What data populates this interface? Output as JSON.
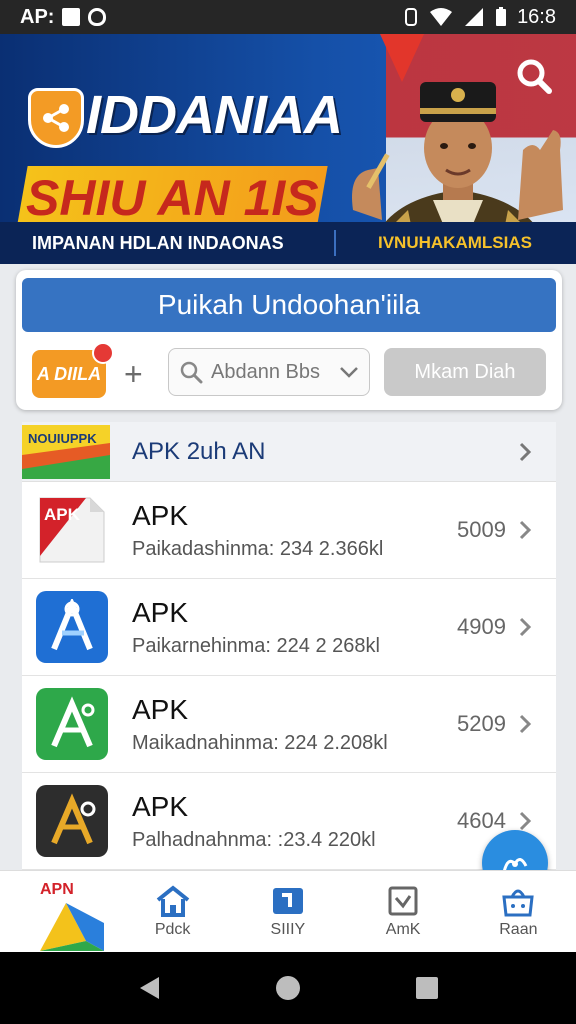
{
  "status_bar": {
    "left_text": "AP:",
    "time": "16:8"
  },
  "banner": {
    "brand": "IDDANIAA",
    "slogan": "SHIU AN 1IS",
    "strip_left": "IMPANAN HDLAN INDAONAS",
    "strip_right": "IVNUHAKAMLSIAS"
  },
  "search_card": {
    "title": "Puikah Undoohan'iila",
    "badge_label": "A DIILA",
    "search_placeholder": "Abdann Bbs",
    "search_button": "Mkam Diah"
  },
  "list": {
    "header_logo_text": "NOUIUPPK",
    "header_title": "APK 2uh AN",
    "items": [
      {
        "name": "APK",
        "sub": "Paikadashinma: 234 2.366kl",
        "num": "5009",
        "icon_badge": "APK"
      },
      {
        "name": "APK",
        "sub": "Paikarnehinma: 224 2 268kl",
        "num": "4909"
      },
      {
        "name": "APK",
        "sub": "Maikadnahinma: 224 2.208kl",
        "num": "5209"
      },
      {
        "name": "APK",
        "sub": "Palhadnahnma: :23.4 220kl",
        "num": "4604"
      }
    ]
  },
  "bottom_nav": {
    "logo_text": "APN",
    "items": [
      {
        "label": "Pdck",
        "icon": "home-icon"
      },
      {
        "label": "SIIIY",
        "icon": "box-icon"
      },
      {
        "label": "AmK",
        "icon": "checkbox-icon"
      },
      {
        "label": "Raan",
        "icon": "bag-icon"
      }
    ]
  },
  "colors": {
    "primary": "#3673c2",
    "banner_dark": "#0b2456",
    "accent_orange": "#f39a24"
  }
}
